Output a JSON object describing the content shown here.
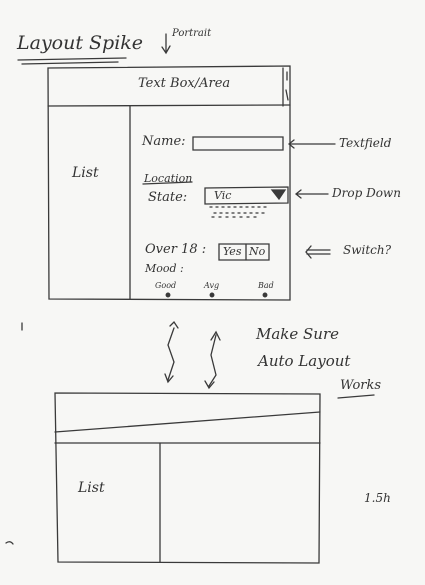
{
  "header": {
    "title": "Layout Spike",
    "orientation": "Portrait"
  },
  "portrait_mockup": {
    "title_bar": "Text Box/Area",
    "list_label": "List",
    "form": {
      "name_label": "Name:",
      "location_label_struck": "Location",
      "state_label": "State:",
      "state_value": "Vic",
      "over18_label": "Over 18 :",
      "over18_yes": "Yes",
      "over18_no": "No",
      "mood_label": "Mood :",
      "mood_options": [
        "Good",
        "Avg",
        "Bad"
      ]
    }
  },
  "annotations": {
    "textfield": "Textfield",
    "dropdown": "Drop Down",
    "switch": "Switch?"
  },
  "note": {
    "line1": "Make Sure",
    "line2": "Auto Layout",
    "line3": "Works"
  },
  "landscape_mockup": {
    "list_label": "List",
    "estimate": "1.5h"
  },
  "colors": {
    "ink": "#3a3a3a",
    "paper": "#f7f7f5"
  }
}
